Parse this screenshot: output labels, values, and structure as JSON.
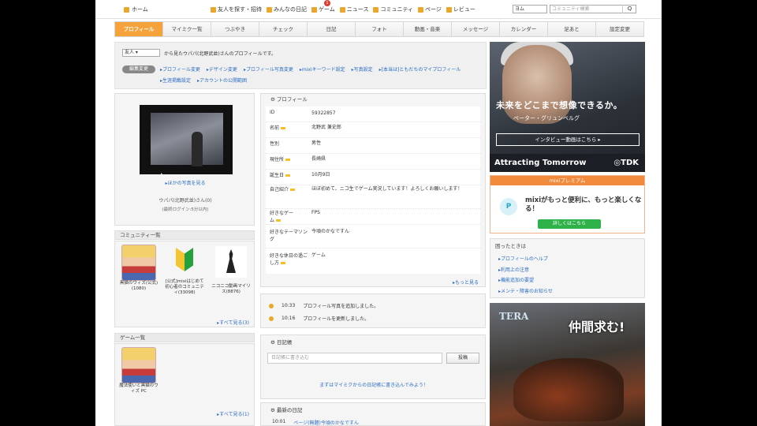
{
  "topnav": {
    "home": "ホーム",
    "links": [
      {
        "label": "友人を探す・招待",
        "icon": "people-icon"
      },
      {
        "label": "みんなの日記",
        "icon": "diary-icon"
      },
      {
        "label": "ゲーム",
        "icon": "game-icon"
      },
      {
        "label": "ニュース",
        "icon": "news-icon"
      },
      {
        "label": "コミュニティ",
        "icon": "community-icon"
      },
      {
        "label": "ページ",
        "icon": "page-icon"
      },
      {
        "label": "レビュー",
        "icon": "review-icon"
      }
    ],
    "game_badge": "1",
    "search_scope": "ヨム",
    "search_placeholder": "コミュニティ検索",
    "search_button": "Q"
  },
  "tabs": [
    "プロフィール",
    "マイミク一覧",
    "つぶやき",
    "チェック",
    "日記",
    "フォト",
    "動画・音楽",
    "メッセージ",
    "カレンダー",
    "足あと",
    "設定変更"
  ],
  "viewer": {
    "select_value": "友人",
    "text": "から見たウパパ(北野武並)さんのプロフィールです。"
  },
  "edit": {
    "label": "編集変更",
    "links": [
      "プロフィール変更",
      "デザイン変更",
      "プロフィール写真変更",
      "mixiキーワード設定",
      "写真設定",
      "[本当は]ともだちのマイプロフィール",
      "生涯掲載設定",
      "アカウントの公開範囲"
    ]
  },
  "photo_panel": {
    "more_photos": "ほかの写真を見る",
    "user_name": "ウパパ(北野武並)さん(0)",
    "user_status": "(最終ログイン:5分以内)"
  },
  "community": {
    "title": "コミュニティ一覧",
    "items": [
      {
        "label": "黒猫のウィズ(公式)(1080)",
        "kind": "anime"
      },
      {
        "label": "[公式]mixiはじめて初心者のコミュニティ(33098)",
        "kind": "beginner"
      },
      {
        "label": "ニコニコ動画マイリス(8876)",
        "kind": "nico"
      }
    ],
    "see_all": "すべて見る(3)"
  },
  "games": {
    "title": "ゲーム一覧",
    "items": [
      {
        "label": "魔法使いと黒猫のウィズ PC"
      }
    ],
    "see_all": "すべて見る(1)"
  },
  "profile": {
    "title": "プロフィール",
    "rows": [
      {
        "key": "ID",
        "value": "59322857",
        "flag": false
      },
      {
        "key": "名前",
        "value": "北野武 兼史郎",
        "flag": true
      },
      {
        "key": "性別",
        "value": "男性",
        "flag": false
      },
      {
        "key": "現住所",
        "value": "長崎県",
        "flag": true
      },
      {
        "key": "誕生日",
        "value": "10月9日",
        "flag": true
      },
      {
        "key": "自己紹介",
        "value": "ほぼ初めて、ニコ生でゲーム実況しています！よろしくお願いします！",
        "flag": true
      },
      {
        "key": "好きなゲーム",
        "value": "FPS",
        "flag": true
      },
      {
        "key": "好きなテーマソング",
        "value": "今頃のかなですん",
        "flag": false
      },
      {
        "key": "好きな休日の過ごし方",
        "value": "ゲーム",
        "flag": true
      }
    ],
    "more": "もっと見る"
  },
  "activity": [
    {
      "time": "10:33",
      "text": "プロフィール写真を追加しました。"
    },
    {
      "time": "10:16",
      "text": "プロフィールを更新しました。"
    }
  ],
  "diary": {
    "title": "日記帳",
    "placeholder": "日記帳に書き込む",
    "button": "投稿",
    "hint": "まずはマイミクからの日記帳に書き込んでみよう！"
  },
  "recent": {
    "title": "最新の日記",
    "time": "10:01",
    "text": "ページ(無題)今頃のかなですん"
  },
  "ads": {
    "tdk": {
      "copy": "未来をどこまで想像できるか。",
      "name": "ペーター・グリュンベルグ",
      "button": "インタビュー動画はこちら",
      "footer": "Attracting Tomorrow",
      "brand": "◎TDK"
    },
    "mmo": {
      "logo": "TERA",
      "copy": "仲間求む!"
    }
  },
  "premium": {
    "head": "mixiプレミアム",
    "icon_text": "P",
    "message": "mixiがもっと便利に、もっと楽しくなる！",
    "button": "詳しくはこちら"
  },
  "help": {
    "title": "困ったときは",
    "links": [
      "プロフィールのヘルプ",
      "利用上の注意",
      "機能追加の要望",
      "メンテ・障害のお知らせ"
    ]
  }
}
